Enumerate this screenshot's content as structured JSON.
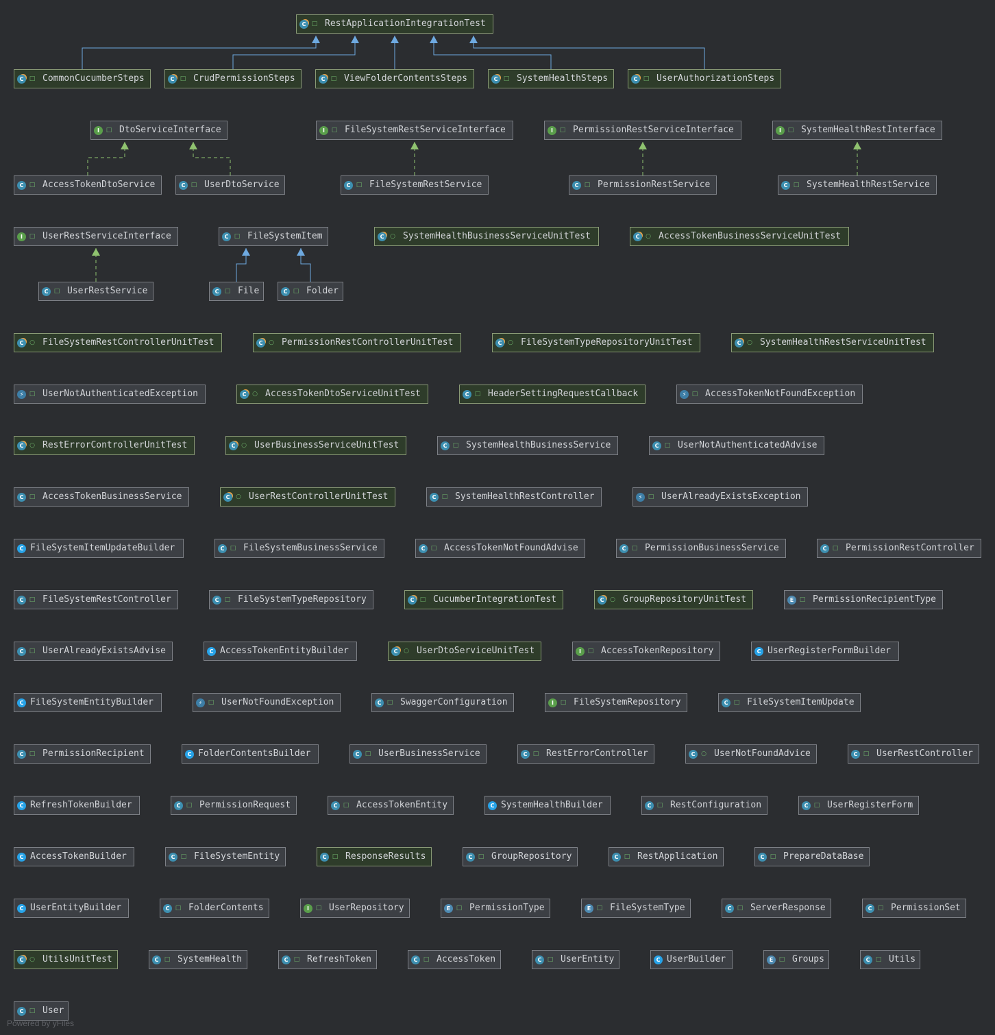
{
  "diagram": {
    "colors": {
      "background": "#2b2d30",
      "node_fill": "#3c3f44",
      "test_node_fill": "#2e3c2a",
      "extends_edge": "#6ea9e0",
      "implements_edge": "#8fc26f"
    },
    "legend_icons": {
      "class": "class-icon",
      "interface": "interface-icon",
      "exception": "exception-icon",
      "enum": "enum-icon",
      "builder": "builder-icon",
      "test": "test-class-icon",
      "public": "lock-open-icon",
      "package": "circle-icon"
    },
    "nodes": [
      {
        "id": "RestApplicationIntegrationTest",
        "kind": "test",
        "vis": "public",
        "test": true
      },
      {
        "id": "CommonCucumberSteps",
        "kind": "test",
        "vis": "public",
        "test": true
      },
      {
        "id": "CrudPermissionSteps",
        "kind": "test",
        "vis": "public",
        "test": true
      },
      {
        "id": "ViewFolderContentsSteps",
        "kind": "test",
        "vis": "public",
        "test": true
      },
      {
        "id": "SystemHealthSteps",
        "kind": "test",
        "vis": "public",
        "test": true
      },
      {
        "id": "UserAuthorizationSteps",
        "kind": "test",
        "vis": "public",
        "test": true
      },
      {
        "id": "DtoServiceInterface",
        "kind": "interface",
        "vis": "public"
      },
      {
        "id": "FileSystemRestServiceInterface",
        "kind": "interface",
        "vis": "public"
      },
      {
        "id": "PermissionRestServiceInterface",
        "kind": "interface",
        "vis": "public"
      },
      {
        "id": "SystemHealthRestInterface",
        "kind": "interface",
        "vis": "public"
      },
      {
        "id": "AccessTokenDtoService",
        "kind": "class",
        "vis": "public"
      },
      {
        "id": "UserDtoService",
        "kind": "class",
        "vis": "public"
      },
      {
        "id": "FileSystemRestService",
        "kind": "class",
        "vis": "public"
      },
      {
        "id": "PermissionRestService",
        "kind": "class",
        "vis": "public"
      },
      {
        "id": "SystemHealthRestService",
        "kind": "class",
        "vis": "public"
      },
      {
        "id": "UserRestServiceInterface",
        "kind": "interface",
        "vis": "public"
      },
      {
        "id": "FileSystemItem",
        "kind": "class",
        "vis": "public"
      },
      {
        "id": "SystemHealthBusinessServiceUnitTest",
        "kind": "test",
        "vis": "package",
        "test": true
      },
      {
        "id": "AccessTokenBusinessServiceUnitTest",
        "kind": "test",
        "vis": "package",
        "test": true
      },
      {
        "id": "UserRestService",
        "kind": "class",
        "vis": "public"
      },
      {
        "id": "File",
        "kind": "class",
        "vis": "public"
      },
      {
        "id": "Folder",
        "kind": "class",
        "vis": "public"
      },
      {
        "id": "FileSystemRestControllerUnitTest",
        "kind": "test",
        "vis": "package",
        "test": true
      },
      {
        "id": "PermissionRestControllerUnitTest",
        "kind": "test",
        "vis": "package",
        "test": true
      },
      {
        "id": "FileSystemTypeRepositoryUnitTest",
        "kind": "test",
        "vis": "package",
        "test": true
      },
      {
        "id": "SystemHealthRestServiceUnitTest",
        "kind": "test",
        "vis": "package",
        "test": true
      },
      {
        "id": "UserNotAuthenticatedException",
        "kind": "exception",
        "vis": "public"
      },
      {
        "id": "AccessTokenDtoServiceUnitTest",
        "kind": "test",
        "vis": "package",
        "test": true
      },
      {
        "id": "HeaderSettingRequestCallback",
        "kind": "class",
        "vis": "public",
        "test": true
      },
      {
        "id": "AccessTokenNotFoundException",
        "kind": "exception",
        "vis": "public"
      },
      {
        "id": "RestErrorControllerUnitTest",
        "kind": "test",
        "vis": "package",
        "test": true
      },
      {
        "id": "UserBusinessServiceUnitTest",
        "kind": "test",
        "vis": "package",
        "test": true
      },
      {
        "id": "SystemHealthBusinessService",
        "kind": "class",
        "vis": "public"
      },
      {
        "id": "UserNotAuthenticatedAdvise",
        "kind": "class",
        "vis": "public"
      },
      {
        "id": "AccessTokenBusinessService",
        "kind": "class",
        "vis": "public"
      },
      {
        "id": "UserRestControllerUnitTest",
        "kind": "test",
        "vis": "package",
        "test": true
      },
      {
        "id": "SystemHealthRestController",
        "kind": "class",
        "vis": "public"
      },
      {
        "id": "UserAlreadyExistsException",
        "kind": "exception",
        "vis": "public"
      },
      {
        "id": "FileSystemItemUpdateBuilder",
        "kind": "builder",
        "vis": "none"
      },
      {
        "id": "FileSystemBusinessService",
        "kind": "class",
        "vis": "public"
      },
      {
        "id": "AccessTokenNotFoundAdvise",
        "kind": "class",
        "vis": "public"
      },
      {
        "id": "PermissionBusinessService",
        "kind": "class",
        "vis": "public"
      },
      {
        "id": "PermissionRestController",
        "kind": "class",
        "vis": "public"
      },
      {
        "id": "FileSystemRestController",
        "kind": "class",
        "vis": "public"
      },
      {
        "id": "FileSystemTypeRepository",
        "kind": "class",
        "vis": "public"
      },
      {
        "id": "CucumberIntegrationTest",
        "kind": "test",
        "vis": "public",
        "test": true
      },
      {
        "id": "GroupRepositoryUnitTest",
        "kind": "test",
        "vis": "package",
        "test": true
      },
      {
        "id": "PermissionRecipientType",
        "kind": "enum",
        "vis": "public"
      },
      {
        "id": "UserAlreadyExistsAdvise",
        "kind": "class",
        "vis": "public"
      },
      {
        "id": "AccessTokenEntityBuilder",
        "kind": "builder",
        "vis": "none"
      },
      {
        "id": "UserDtoServiceUnitTest",
        "kind": "test",
        "vis": "package",
        "test": true
      },
      {
        "id": "AccessTokenRepository",
        "kind": "interface",
        "vis": "public"
      },
      {
        "id": "UserRegisterFormBuilder",
        "kind": "builder",
        "vis": "none"
      },
      {
        "id": "FileSystemEntityBuilder",
        "kind": "builder",
        "vis": "none"
      },
      {
        "id": "UserNotFoundException",
        "kind": "exception",
        "vis": "public"
      },
      {
        "id": "SwaggerConfiguration",
        "kind": "class",
        "vis": "public"
      },
      {
        "id": "FileSystemRepository",
        "kind": "interface",
        "vis": "public"
      },
      {
        "id": "FileSystemItemUpdate",
        "kind": "class",
        "vis": "public"
      },
      {
        "id": "PermissionRecipient",
        "kind": "class",
        "vis": "public"
      },
      {
        "id": "FolderContentsBuilder",
        "kind": "builder",
        "vis": "none"
      },
      {
        "id": "UserBusinessService",
        "kind": "class",
        "vis": "public"
      },
      {
        "id": "RestErrorController",
        "kind": "class",
        "vis": "public"
      },
      {
        "id": "UserNotFoundAdvice",
        "kind": "class",
        "vis": "package"
      },
      {
        "id": "UserRestController",
        "kind": "class",
        "vis": "public"
      },
      {
        "id": "RefreshTokenBuilder",
        "kind": "builder",
        "vis": "none"
      },
      {
        "id": "PermissionRequest",
        "kind": "class",
        "vis": "public"
      },
      {
        "id": "AccessTokenEntity",
        "kind": "class",
        "vis": "public"
      },
      {
        "id": "SystemHealthBuilder",
        "kind": "builder",
        "vis": "none"
      },
      {
        "id": "RestConfiguration",
        "kind": "class",
        "vis": "public"
      },
      {
        "id": "UserRegisterForm",
        "kind": "class",
        "vis": "public"
      },
      {
        "id": "AccessTokenBuilder",
        "kind": "builder",
        "vis": "none"
      },
      {
        "id": "FileSystemEntity",
        "kind": "class",
        "vis": "public"
      },
      {
        "id": "ResponseResults",
        "kind": "class",
        "vis": "public",
        "test": true
      },
      {
        "id": "GroupRepository",
        "kind": "class",
        "vis": "public"
      },
      {
        "id": "RestApplication",
        "kind": "class",
        "vis": "public"
      },
      {
        "id": "PrepareDataBase",
        "kind": "class",
        "vis": "public"
      },
      {
        "id": "UserEntityBuilder",
        "kind": "builder",
        "vis": "none"
      },
      {
        "id": "FolderContents",
        "kind": "class",
        "vis": "public"
      },
      {
        "id": "UserRepository",
        "kind": "interface",
        "vis": "public"
      },
      {
        "id": "PermissionType",
        "kind": "enum",
        "vis": "public"
      },
      {
        "id": "FileSystemType",
        "kind": "enum",
        "vis": "public"
      },
      {
        "id": "ServerResponse",
        "kind": "class",
        "vis": "public"
      },
      {
        "id": "PermissionSet",
        "kind": "class",
        "vis": "public"
      },
      {
        "id": "UtilsUnitTest",
        "kind": "test",
        "vis": "package",
        "test": true
      },
      {
        "id": "SystemHealth",
        "kind": "class",
        "vis": "public"
      },
      {
        "id": "RefreshToken",
        "kind": "class",
        "vis": "public"
      },
      {
        "id": "AccessToken",
        "kind": "class",
        "vis": "public"
      },
      {
        "id": "UserEntity",
        "kind": "class",
        "vis": "public"
      },
      {
        "id": "UserBuilder",
        "kind": "builder",
        "vis": "none"
      },
      {
        "id": "Groups",
        "kind": "enum",
        "vis": "public"
      },
      {
        "id": "Utils",
        "kind": "class",
        "vis": "public"
      },
      {
        "id": "User",
        "kind": "class",
        "vis": "public"
      }
    ],
    "edges": [
      {
        "from": "CommonCucumberSteps",
        "to": "RestApplicationIntegrationTest",
        "type": "extends"
      },
      {
        "from": "CrudPermissionSteps",
        "to": "RestApplicationIntegrationTest",
        "type": "extends"
      },
      {
        "from": "ViewFolderContentsSteps",
        "to": "RestApplicationIntegrationTest",
        "type": "extends"
      },
      {
        "from": "SystemHealthSteps",
        "to": "RestApplicationIntegrationTest",
        "type": "extends"
      },
      {
        "from": "UserAuthorizationSteps",
        "to": "RestApplicationIntegrationTest",
        "type": "extends"
      },
      {
        "from": "AccessTokenDtoService",
        "to": "DtoServiceInterface",
        "type": "implements"
      },
      {
        "from": "UserDtoService",
        "to": "DtoServiceInterface",
        "type": "implements"
      },
      {
        "from": "FileSystemRestService",
        "to": "FileSystemRestServiceInterface",
        "type": "implements"
      },
      {
        "from": "PermissionRestService",
        "to": "PermissionRestServiceInterface",
        "type": "implements"
      },
      {
        "from": "SystemHealthRestService",
        "to": "SystemHealthRestInterface",
        "type": "implements"
      },
      {
        "from": "UserRestService",
        "to": "UserRestServiceInterface",
        "type": "implements"
      },
      {
        "from": "File",
        "to": "FileSystemItem",
        "type": "extends"
      },
      {
        "from": "Folder",
        "to": "FileSystemItem",
        "type": "extends"
      }
    ],
    "footer": "Powered by yFiles"
  }
}
